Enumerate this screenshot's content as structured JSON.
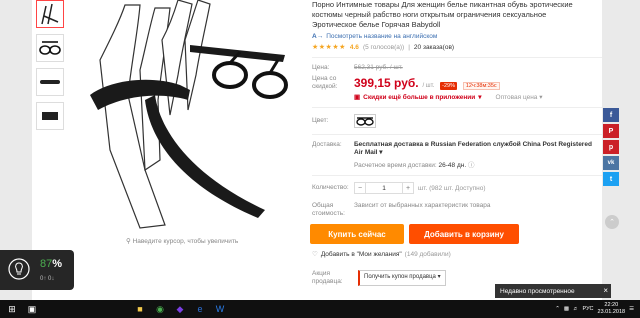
{
  "product": {
    "title": "Порно Интимные товары Для женщин белье пикантная обувь эротические костюмы черный рабство ноги открытым ограничения сексуальное Эротическое белье Горячая Babydoll",
    "translate_link": "Посмотреть название на английском",
    "rating_value": "4.6",
    "votes": "(5 голосов(а))",
    "orders": "20 заказа(ов)",
    "zoom_hint": "Наведите курсор, чтобы увеличить"
  },
  "price": {
    "label": "Цена:",
    "old": "562,31 руб. / шт.",
    "discount_label": "Цена со скидкой:",
    "new": "399,15 руб.",
    "unit": "/ шт.",
    "badge": "-29%",
    "timer": "12ч:38м:35с",
    "app_discount": "Скидки ещё больше в приложении",
    "wholesale": "Оптовая цена"
  },
  "color": {
    "label": "Цвет:"
  },
  "shipping": {
    "label": "Доставка:",
    "text": "Бесплатная доставка в Russian Federation службой China Post Registered Air Mail",
    "eta_label": "Расчетное время доставки:",
    "eta": "26-48 дн."
  },
  "quantity": {
    "label": "Количество:",
    "value": "1",
    "minus": "−",
    "plus": "+",
    "available": "шт. (982 шт. Доступно)"
  },
  "total": {
    "label": "Общая стоимость:",
    "text": "Зависит от выбранных характеристик товара"
  },
  "actions": {
    "buy_now": "Купить сейчас",
    "add_to_cart": "Добавить в корзину",
    "wishlist": "Добавить в \"Мои желания\"",
    "wishlist_count": "(149 добавили)"
  },
  "promo": {
    "label": "Акция продавца:",
    "coupon": "Получить купон продавца"
  },
  "share": [
    "f",
    "P",
    "p",
    "vk",
    "t"
  ],
  "recent": {
    "label": "Недавно просмотренное"
  },
  "widget": {
    "percent": "87",
    "percent_sign": "%",
    "io": "0↑ 0↓"
  },
  "tray": {
    "lang": "РУС",
    "time": "22:20",
    "date": "23.01.2018"
  },
  "colors": {
    "accent": "#ff4e00",
    "buy": "#ff8a00",
    "price": "#d0021b",
    "facebook": "#3b5998",
    "pinterest": "#cb2027",
    "vk": "#4c75a3",
    "twitter": "#1da1f2"
  }
}
